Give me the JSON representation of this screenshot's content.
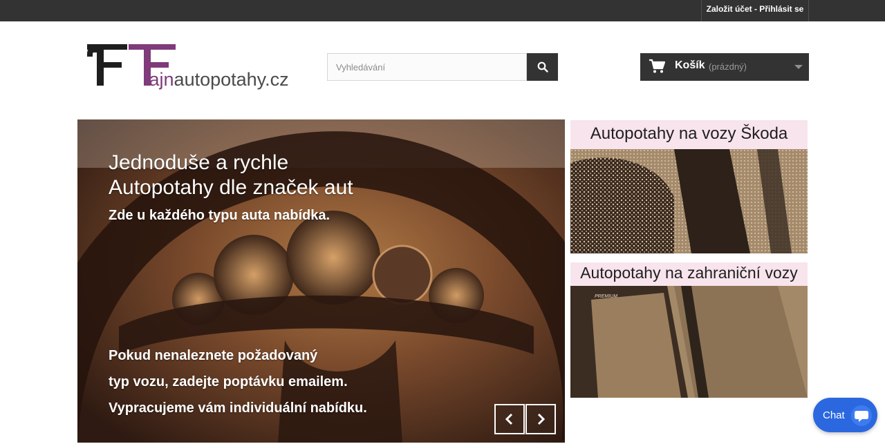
{
  "topbar": {
    "account_link": "Založit účet - Přihlásit se"
  },
  "logo": {
    "prefix": "fajn",
    "suffix": "autopotahy.cz",
    "accent_color": "#7f3b7a"
  },
  "search": {
    "placeholder": "Vyhledávání",
    "icon": "search-icon"
  },
  "cart": {
    "label": "Košík",
    "state": "(prázdný)",
    "icon": "cart-icon"
  },
  "slider": {
    "heading_line1": "Jednoduše a rychle",
    "heading_line2": "Autopotahy dle značek aut",
    "subheading": "Zde u každého typu auta nabídka.",
    "text_line1": "Pokud nenaleznete požadovaný",
    "text_line2": "typ vozu, zadejte poptávku emailem.",
    "text_line3": "Vypracujeme vám individuální nabídku."
  },
  "banners": [
    {
      "title": "Autopotahy na vozy Škoda"
    },
    {
      "title": "Autopotahy na zahraniční vozy",
      "image_label": "PREMIUM"
    }
  ],
  "chat": {
    "label": "Chat",
    "accent": "#2b68e0"
  }
}
